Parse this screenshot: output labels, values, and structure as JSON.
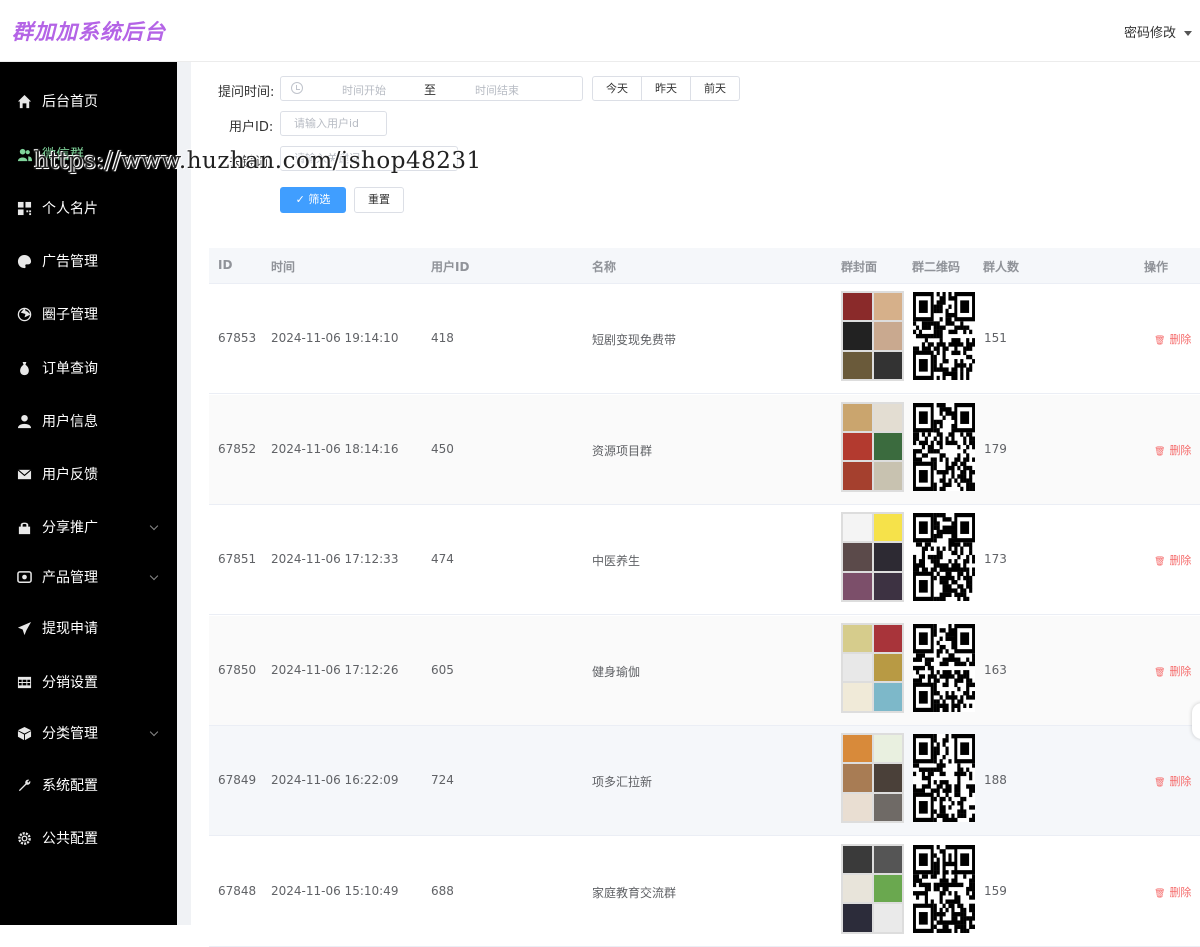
{
  "header": {
    "logo": "群加加系统后台",
    "password_menu": "密码修改"
  },
  "sidebar": {
    "items": [
      {
        "label": "后台首页",
        "icon": "home-icon",
        "active": false,
        "expandable": false
      },
      {
        "label": "微信群",
        "icon": "users-icon",
        "active": true,
        "expandable": false
      },
      {
        "label": "个人名片",
        "icon": "qrcode-icon",
        "active": false,
        "expandable": false
      },
      {
        "label": "广告管理",
        "icon": "palette-icon",
        "active": false,
        "expandable": false
      },
      {
        "label": "圈子管理",
        "icon": "aperture-icon",
        "active": false,
        "expandable": false
      },
      {
        "label": "订单查询",
        "icon": "money-bag-icon",
        "active": false,
        "expandable": false
      },
      {
        "label": "用户信息",
        "icon": "user-icon",
        "active": false,
        "expandable": false
      },
      {
        "label": "用户反馈",
        "icon": "mail-icon",
        "active": false,
        "expandable": false
      },
      {
        "label": "分享推广",
        "icon": "lock-bag-icon",
        "active": false,
        "expandable": true
      },
      {
        "label": "产品管理",
        "icon": "product-icon",
        "active": false,
        "expandable": true
      },
      {
        "label": "提现申请",
        "icon": "paper-plane-icon",
        "active": false,
        "expandable": false
      },
      {
        "label": "分销设置",
        "icon": "table-icon",
        "active": false,
        "expandable": false
      },
      {
        "label": "分类管理",
        "icon": "cube-icon",
        "active": false,
        "expandable": true
      },
      {
        "label": "系统配置",
        "icon": "tools-icon",
        "active": false,
        "expandable": false
      },
      {
        "label": "公共配置",
        "icon": "gear-icon",
        "active": false,
        "expandable": false
      }
    ]
  },
  "filters": {
    "time_label": "提问时间:",
    "start_placeholder": "时间开始",
    "range_sep": "至",
    "end_placeholder": "时间结束",
    "quick": [
      "今天",
      "昨天",
      "前天"
    ],
    "userid_label": "用户ID:",
    "userid_placeholder": "请输入用户id",
    "keyword_label": "关键词:",
    "keyword_placeholder": "请输入关键词",
    "filter_button": "筛选",
    "reset_button": "重置"
  },
  "watermark": "https://www.huzhan.com/ishop48231",
  "table": {
    "columns": [
      "ID",
      "时间",
      "用户ID",
      "名称",
      "群封面",
      "群二维码",
      "群人数",
      "操作"
    ],
    "delete_label": "删除",
    "rows": [
      {
        "id": "67853",
        "time": "2024-11-06 19:14:10",
        "user_id": "418",
        "name": "短剧变现免费带",
        "members": "151"
      },
      {
        "id": "67852",
        "time": "2024-11-06 18:14:16",
        "user_id": "450",
        "name": "资源项目群",
        "members": "179"
      },
      {
        "id": "67851",
        "time": "2024-11-06 17:12:33",
        "user_id": "474",
        "name": "中医养生",
        "members": "173"
      },
      {
        "id": "67850",
        "time": "2024-11-06 17:12:26",
        "user_id": "605",
        "name": "健身瑜伽",
        "members": "163"
      },
      {
        "id": "67849",
        "time": "2024-11-06 16:22:09",
        "user_id": "724",
        "name": "项多汇拉新",
        "members": "188"
      },
      {
        "id": "67848",
        "time": "2024-11-06 15:10:49",
        "user_id": "688",
        "name": "家庭教育交流群",
        "members": "159"
      }
    ]
  }
}
